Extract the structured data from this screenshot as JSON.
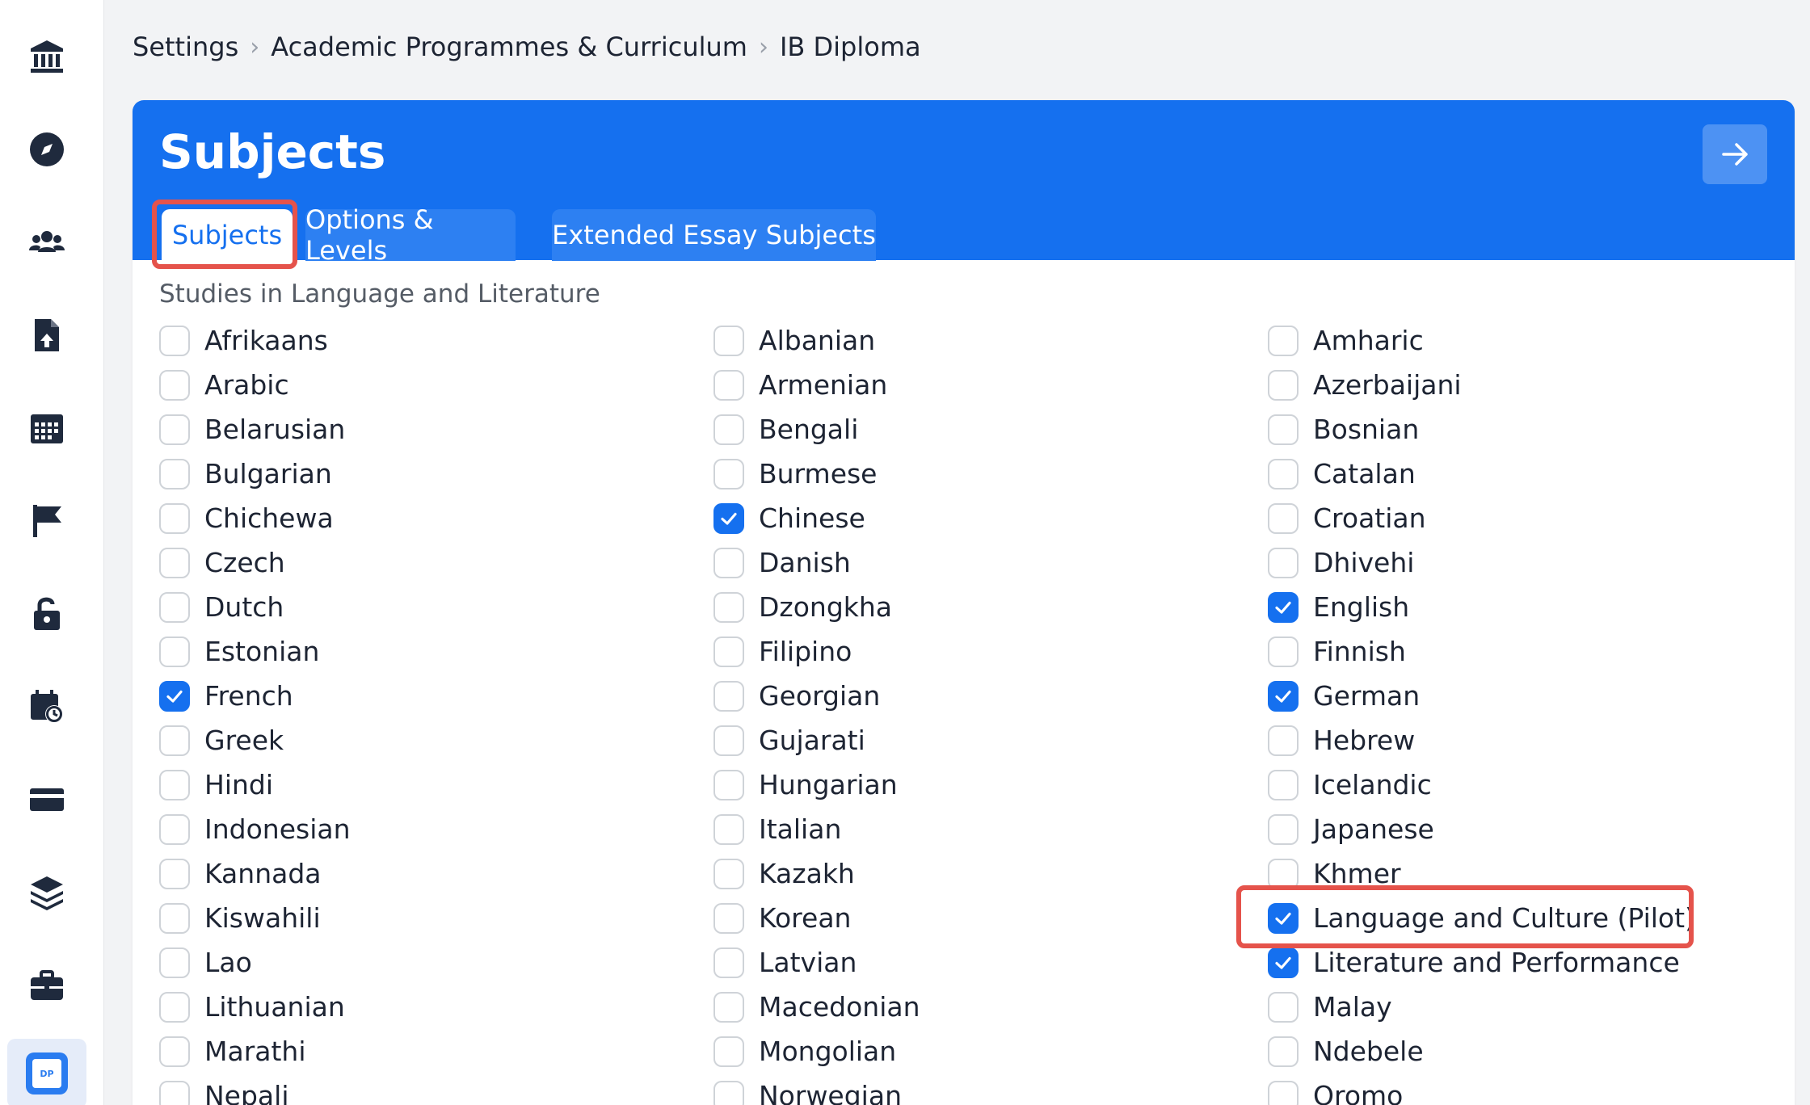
{
  "breadcrumb": [
    "Settings",
    "Academic Programmes & Curriculum",
    "IB Diploma"
  ],
  "page": {
    "title": "Subjects",
    "tabs": [
      {
        "label": "Subjects",
        "active": true
      },
      {
        "label": "Options & Levels",
        "active": false
      },
      {
        "label": "Extended Essay Subjects",
        "active": false
      }
    ],
    "section_title": "Studies in Language and Literature"
  },
  "sidebar": {
    "icons": [
      "institution-icon",
      "compass-icon",
      "users-icon",
      "document-upload-icon",
      "calendar-grid-icon",
      "flag-icon",
      "unlock-icon",
      "calendar-clock-icon",
      "credit-card-icon",
      "layers-icon",
      "briefcase-icon",
      "dp-icon"
    ],
    "active_badge": "DP"
  },
  "columns": [
    [
      {
        "label": "Afrikaans",
        "checked": false
      },
      {
        "label": "Arabic",
        "checked": false
      },
      {
        "label": "Belarusian",
        "checked": false
      },
      {
        "label": "Bulgarian",
        "checked": false
      },
      {
        "label": "Chichewa",
        "checked": false
      },
      {
        "label": "Czech",
        "checked": false
      },
      {
        "label": "Dutch",
        "checked": false
      },
      {
        "label": "Estonian",
        "checked": false
      },
      {
        "label": "French",
        "checked": true
      },
      {
        "label": "Greek",
        "checked": false
      },
      {
        "label": "Hindi",
        "checked": false
      },
      {
        "label": "Indonesian",
        "checked": false
      },
      {
        "label": "Kannada",
        "checked": false
      },
      {
        "label": "Kiswahili",
        "checked": false
      },
      {
        "label": "Lao",
        "checked": false
      },
      {
        "label": "Lithuanian",
        "checked": false
      },
      {
        "label": "Marathi",
        "checked": false
      },
      {
        "label": "Nepali",
        "checked": false
      }
    ],
    [
      {
        "label": "Albanian",
        "checked": false
      },
      {
        "label": "Armenian",
        "checked": false
      },
      {
        "label": "Bengali",
        "checked": false
      },
      {
        "label": "Burmese",
        "checked": false
      },
      {
        "label": "Chinese",
        "checked": true
      },
      {
        "label": "Danish",
        "checked": false
      },
      {
        "label": "Dzongkha",
        "checked": false
      },
      {
        "label": "Filipino",
        "checked": false
      },
      {
        "label": "Georgian",
        "checked": false
      },
      {
        "label": "Gujarati",
        "checked": false
      },
      {
        "label": "Hungarian",
        "checked": false
      },
      {
        "label": "Italian",
        "checked": false
      },
      {
        "label": "Kazakh",
        "checked": false
      },
      {
        "label": "Korean",
        "checked": false
      },
      {
        "label": "Latvian",
        "checked": false
      },
      {
        "label": "Macedonian",
        "checked": false
      },
      {
        "label": "Mongolian",
        "checked": false
      },
      {
        "label": "Norwegian",
        "checked": false
      }
    ],
    [
      {
        "label": "Amharic",
        "checked": false
      },
      {
        "label": "Azerbaijani",
        "checked": false
      },
      {
        "label": "Bosnian",
        "checked": false
      },
      {
        "label": "Catalan",
        "checked": false
      },
      {
        "label": "Croatian",
        "checked": false
      },
      {
        "label": "Dhivehi",
        "checked": false
      },
      {
        "label": "English",
        "checked": true
      },
      {
        "label": "Finnish",
        "checked": false
      },
      {
        "label": "German",
        "checked": true
      },
      {
        "label": "Hebrew",
        "checked": false
      },
      {
        "label": "Icelandic",
        "checked": false
      },
      {
        "label": "Japanese",
        "checked": false
      },
      {
        "label": "Khmer",
        "checked": false
      },
      {
        "label": "Language and Culture (Pilot)",
        "checked": true
      },
      {
        "label": "Literature and Performance",
        "checked": true
      },
      {
        "label": "Malay",
        "checked": false
      },
      {
        "label": "Ndebele",
        "checked": false
      },
      {
        "label": "Oromo",
        "checked": false
      }
    ]
  ],
  "colors": {
    "primary": "#1570ef",
    "highlight": "#e5534b",
    "sidebar_icon": "#1f2a3d"
  }
}
